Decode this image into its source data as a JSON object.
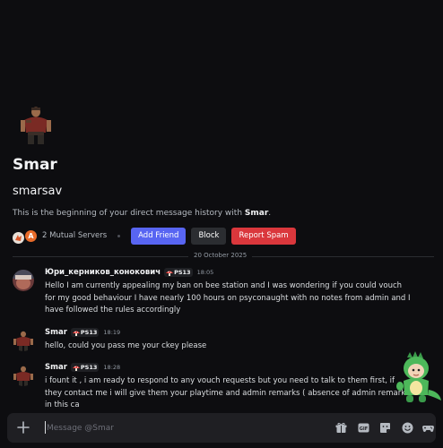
{
  "profile": {
    "display_name": "Smar",
    "username": "smarsav",
    "intro_prefix": "This is the beginning of your direct message history with ",
    "intro_name": "Smar",
    "intro_suffix": "."
  },
  "mutual": {
    "text": "2 Mutual Servers",
    "second_server_letter": "A"
  },
  "actions": {
    "add_friend": "Add Friend",
    "block": "Block",
    "report_spam": "Report Spam"
  },
  "divider": {
    "date": "20 October 2025"
  },
  "messages": [
    {
      "author": "Юри_керников_конокович",
      "tag": "PS13",
      "time": "18:05",
      "text": "Hello I am currently appealing my ban on bee station and I was wondering if you could vouch for my good behaviour I have nearly 100 hours on psyconaught with no notes from admin and I have followed the rules accordingly"
    },
    {
      "author": "Smar",
      "tag": "PS13",
      "time": "18:19",
      "text": "hello, could you pass me your ckey please"
    },
    {
      "author": "Smar",
      "tag": "PS13",
      "time": "18:28",
      "text": "i fount it , i am ready to respond to any vouch requests but you need to talk to them first, if they contact me i will give them your playtime and admin remarks ( absence of admin remarks in this ca"
    }
  ],
  "composer": {
    "placeholder": "Message @Smar"
  },
  "icons": [
    "plus-icon",
    "gift-icon",
    "gif-icon",
    "sticker-icon",
    "emoji-icon",
    "apps-icon"
  ],
  "colors": {
    "background": "#0d0d10",
    "blurple": "#5865f2",
    "danger": "#da373c",
    "neutral_button": "#2b2d31"
  }
}
